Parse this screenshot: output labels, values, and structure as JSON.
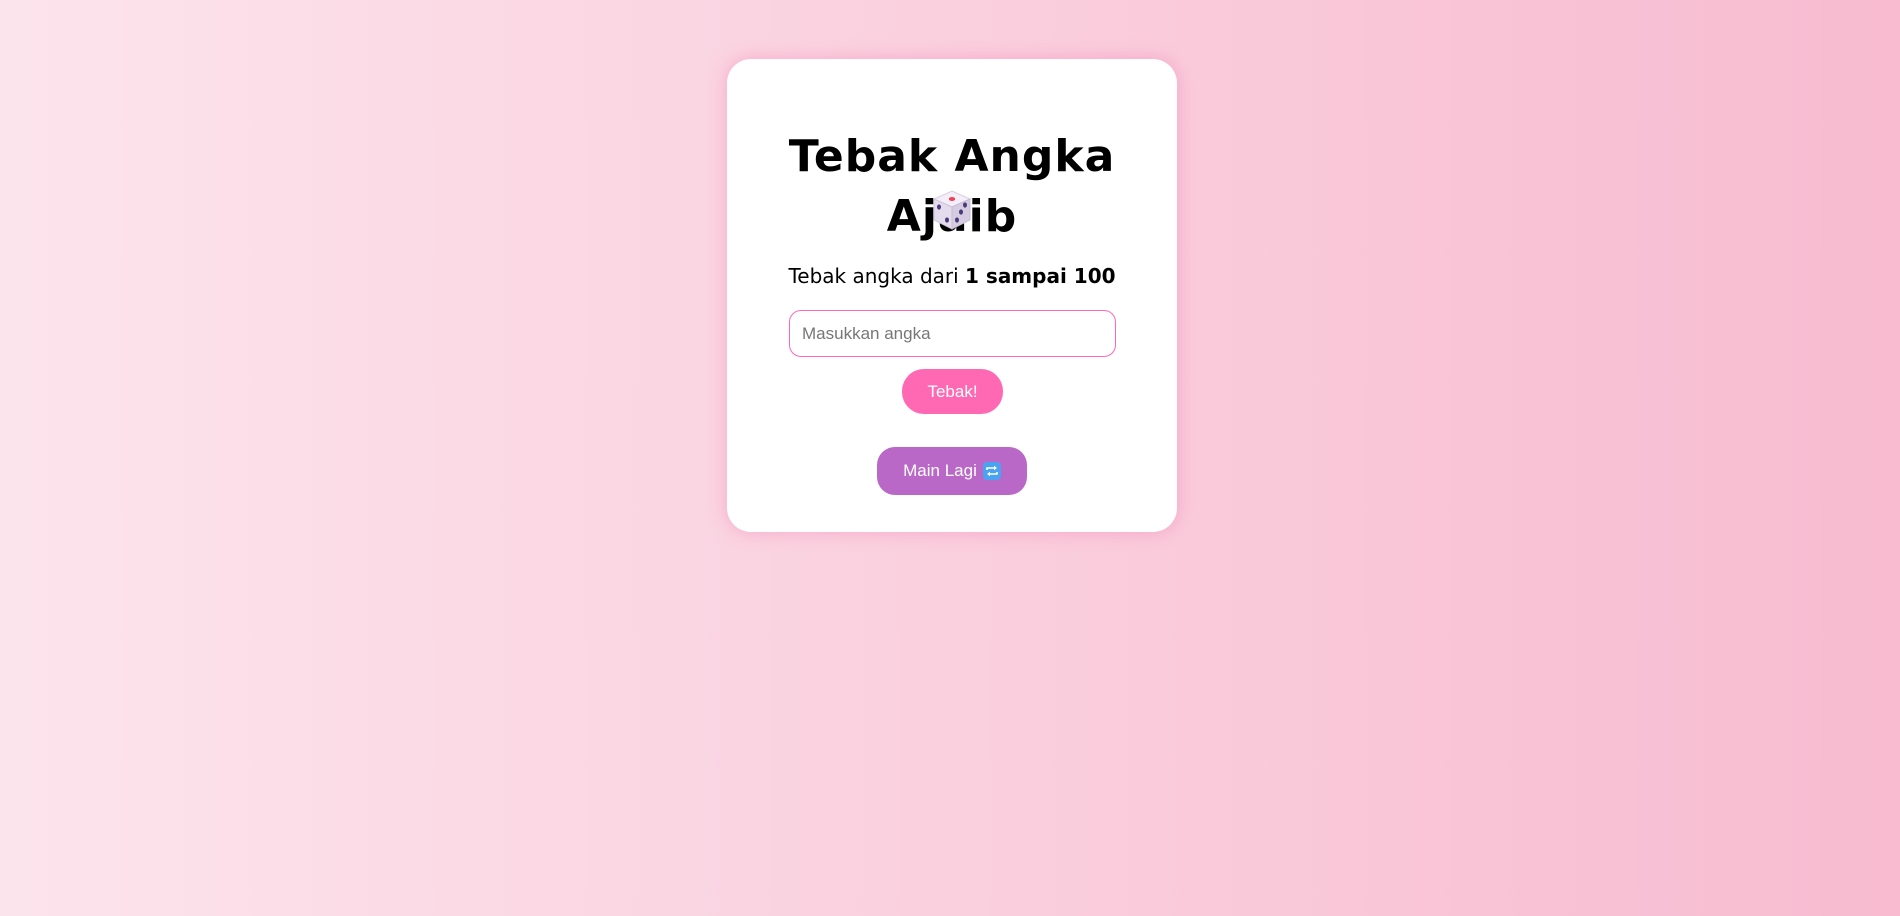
{
  "game": {
    "title": "Tebak Angka Ajaib",
    "title_icon": "dice-icon",
    "instruction_prefix": "Tebak angka dari ",
    "instruction_range": "1 sampai 100",
    "input": {
      "value": "",
      "placeholder": "Masukkan angka"
    },
    "guess_button_label": "Tebak!",
    "replay_button_label": "Main Lagi",
    "replay_icon": "repeat-icon"
  },
  "colors": {
    "background_start": "#fce4ec",
    "background_end": "#f8bbd0",
    "guess_button": "#ff69b4",
    "replay_button": "#ba68c8",
    "input_border": "#ff69b4"
  }
}
